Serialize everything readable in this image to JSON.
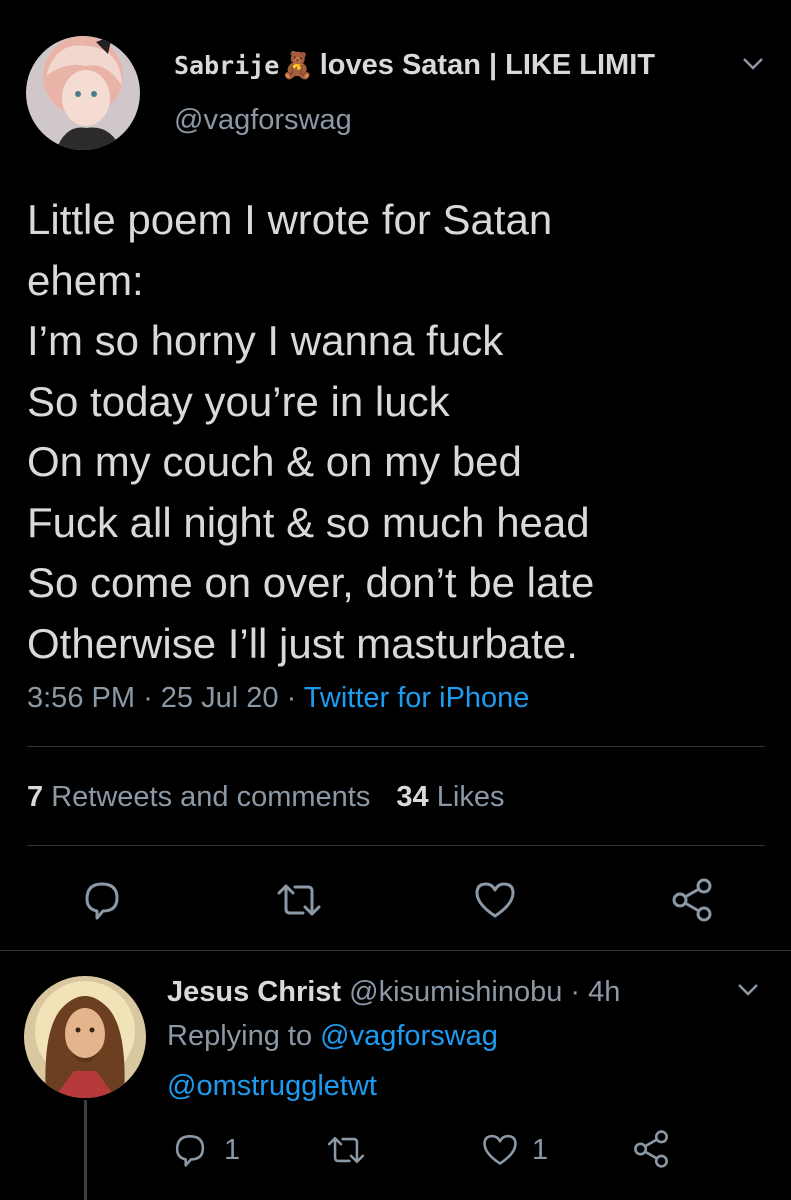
{
  "tweet": {
    "display_name_part1": "Sabrije",
    "display_name_emoji": "🧸",
    "display_name_part2": "loves Satan | LIKE LIMIT",
    "handle": "@vagforswag",
    "lines": [
      "Little poem I wrote for Satan",
      "ehem:",
      "I’m so horny I wanna fuck",
      "So today you’re in luck",
      "On my couch & on my bed",
      "Fuck all night & so much head",
      "So come on over, don’t be late",
      "Otherwise I’ll just masturbate."
    ],
    "time": "3:56 PM",
    "date": "25 Jul 20",
    "source": "Twitter for iPhone",
    "sep": "·",
    "retweets_count": "7",
    "retweets_label": "Retweets and comments",
    "likes_count": "34",
    "likes_label": "Likes"
  },
  "reply": {
    "display_name": "Jesus Christ",
    "handle": "@kisumishinobu",
    "sep": "·",
    "age": "4h",
    "replying_to_label": "Replying to",
    "replying_to_handle": "@vagforswag",
    "mention": "@omstruggletwt",
    "reply_count": "1",
    "like_count": "1"
  },
  "colors": {
    "background": "#000000",
    "text": "#d9d9d9",
    "secondary": "#8b98a5",
    "link": "#1d9bf0",
    "divider": "#2f3336"
  },
  "icons": [
    "chevron-down-icon",
    "reply-icon",
    "retweet-icon",
    "heart-icon",
    "share-icon"
  ]
}
